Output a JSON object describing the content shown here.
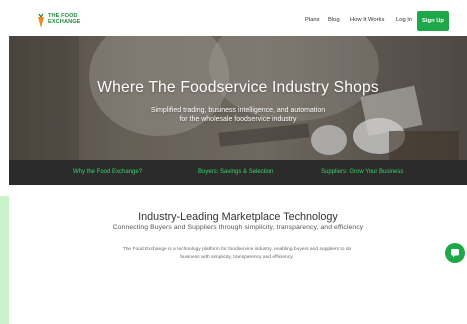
{
  "brand": {
    "logo_text": "THE FOOD\nEXCHANGE",
    "colors": {
      "green": "#1ea84a",
      "dark_green": "#1f8a3a",
      "strip_bg": "#2b2b2b",
      "strip_link": "#3ed06a"
    }
  },
  "nav": {
    "items": [
      "Plans",
      "Blog",
      "How It Works",
      "Log In"
    ],
    "signup_label": "Sign Up"
  },
  "hero": {
    "title": "Where The Foodservice Industry Shops",
    "subtitle_line1": "Simplified trading, business intelligence, and automation",
    "subtitle_line2": "for the wholesale foodservice industry"
  },
  "strip": {
    "links": [
      "Why the Food Exchange?",
      "Buyers: Savings & Selection",
      "Suppliers: Grow Your Business"
    ]
  },
  "section": {
    "title": "Industry-Leading Marketplace Technology",
    "subtitle": "Connecting Buyers and Suppliers through simplicity, transparency, and efficiency",
    "body": "The Food Exchange is a technology platform for foodservice industry, enabling buyers and suppliers to do business with simplicity, transparency and efficiency."
  },
  "icons": {
    "logo": "carrot-icon",
    "chat": "chat-bubble-icon"
  }
}
